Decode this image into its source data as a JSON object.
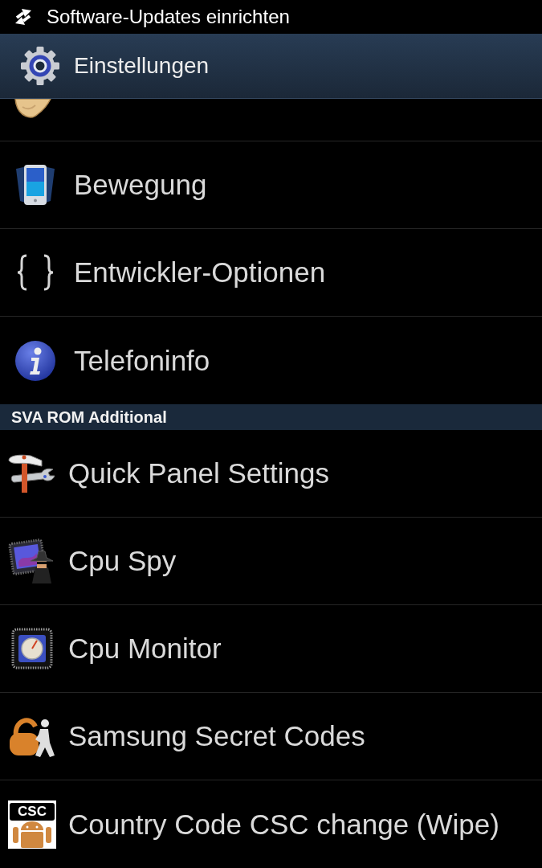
{
  "status_bar": {
    "notification": "Software-Updates einrichten"
  },
  "action_bar": {
    "title": "Einstellungen"
  },
  "sections": [
    {
      "items": [
        {
          "kind": "cut_off"
        },
        {
          "kind": "entry",
          "label": "Bewegung"
        },
        {
          "kind": "entry",
          "label": "Entwickler-Optionen"
        },
        {
          "kind": "entry",
          "label": "Telefoninfo"
        }
      ]
    },
    {
      "header": "SVA ROM Additional",
      "items": [
        {
          "kind": "entry",
          "label": "Quick Panel Settings"
        },
        {
          "kind": "entry",
          "label": "Cpu Spy"
        },
        {
          "kind": "entry",
          "label": "Cpu Monitor"
        },
        {
          "kind": "entry",
          "label": "Samsung Secret Codes"
        },
        {
          "kind": "entry",
          "label": "Country Code CSC change (Wipe)",
          "icon_text": "CSC"
        }
      ]
    }
  ]
}
